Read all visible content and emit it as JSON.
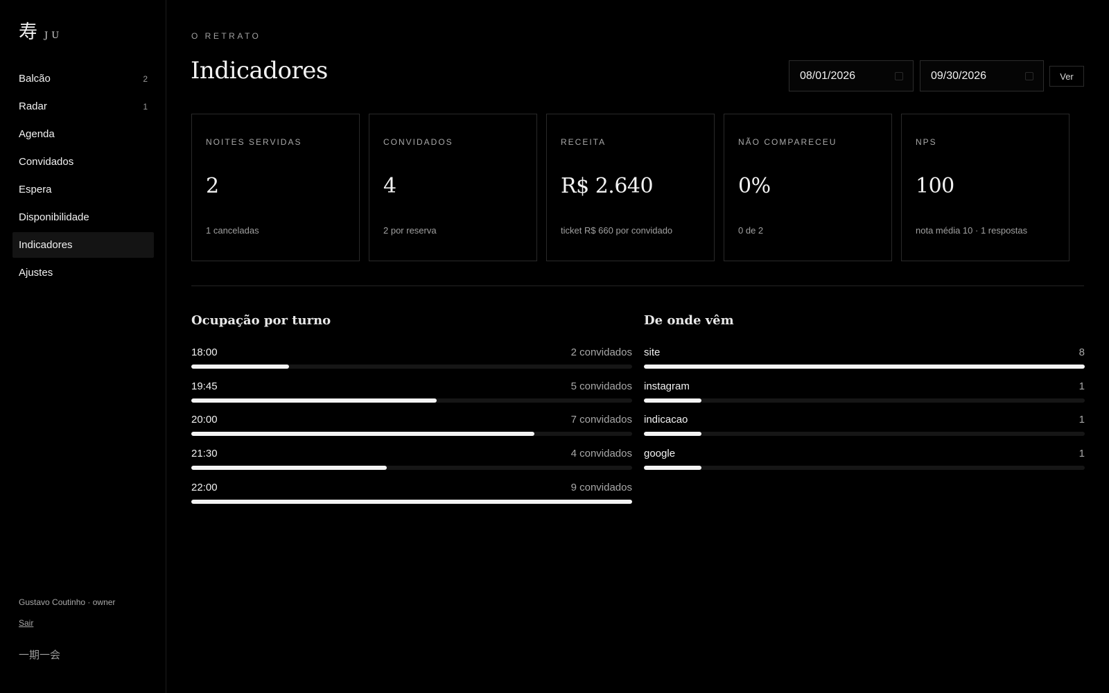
{
  "brand": {
    "kanji": "寿",
    "name": "JU"
  },
  "sidebar": {
    "items": [
      {
        "label": "Balcão",
        "count": "2",
        "active": false
      },
      {
        "label": "Radar",
        "count": "1",
        "active": false
      },
      {
        "label": "Agenda",
        "count": "",
        "active": false
      },
      {
        "label": "Convidados",
        "count": "",
        "active": false
      },
      {
        "label": "Espera",
        "count": "",
        "active": false
      },
      {
        "label": "Disponibilidade",
        "count": "",
        "active": false
      },
      {
        "label": "Indicadores",
        "count": "",
        "active": true
      },
      {
        "label": "Ajustes",
        "count": "",
        "active": false
      }
    ],
    "user": "Gustavo Coutinho · owner",
    "logout": "Sair",
    "motto": "一期一会"
  },
  "header": {
    "eyebrow": "O RETRATO",
    "title": "Indicadores",
    "date_from": "08/01/2026",
    "date_to": "09/30/2026",
    "submit_label": "Ver"
  },
  "cards": [
    {
      "label": "NOITES SERVIDAS",
      "value": "2",
      "sub": "1 canceladas"
    },
    {
      "label": "CONVIDADOS",
      "value": "4",
      "sub": "2 por reserva"
    },
    {
      "label": "RECEITA",
      "value": "R$ 2.640",
      "sub": "ticket R$ 660 por convidado"
    },
    {
      "label": "NÃO COMPARECEU",
      "value": "0%",
      "sub": "0 de 2"
    },
    {
      "label": "NPS",
      "value": "100",
      "sub": "nota média 10 · 1 respostas"
    }
  ],
  "occupancy": {
    "title": "Ocupação por turno",
    "rows": [
      {
        "label": "18:00",
        "value_text": "2 convidados",
        "fraction": 0.222
      },
      {
        "label": "19:45",
        "value_text": "5 convidados",
        "fraction": 0.556
      },
      {
        "label": "20:00",
        "value_text": "7 convidados",
        "fraction": 0.778
      },
      {
        "label": "21:30",
        "value_text": "4 convidados",
        "fraction": 0.444
      },
      {
        "label": "22:00",
        "value_text": "9 convidados",
        "fraction": 1.0
      }
    ]
  },
  "sources": {
    "title": "De onde vêm",
    "rows": [
      {
        "label": "site",
        "value_text": "8",
        "fraction": 1.0
      },
      {
        "label": "instagram",
        "value_text": "1",
        "fraction": 0.13
      },
      {
        "label": "indicacao",
        "value_text": "1",
        "fraction": 0.13
      },
      {
        "label": "google",
        "value_text": "1",
        "fraction": 0.13
      }
    ]
  }
}
